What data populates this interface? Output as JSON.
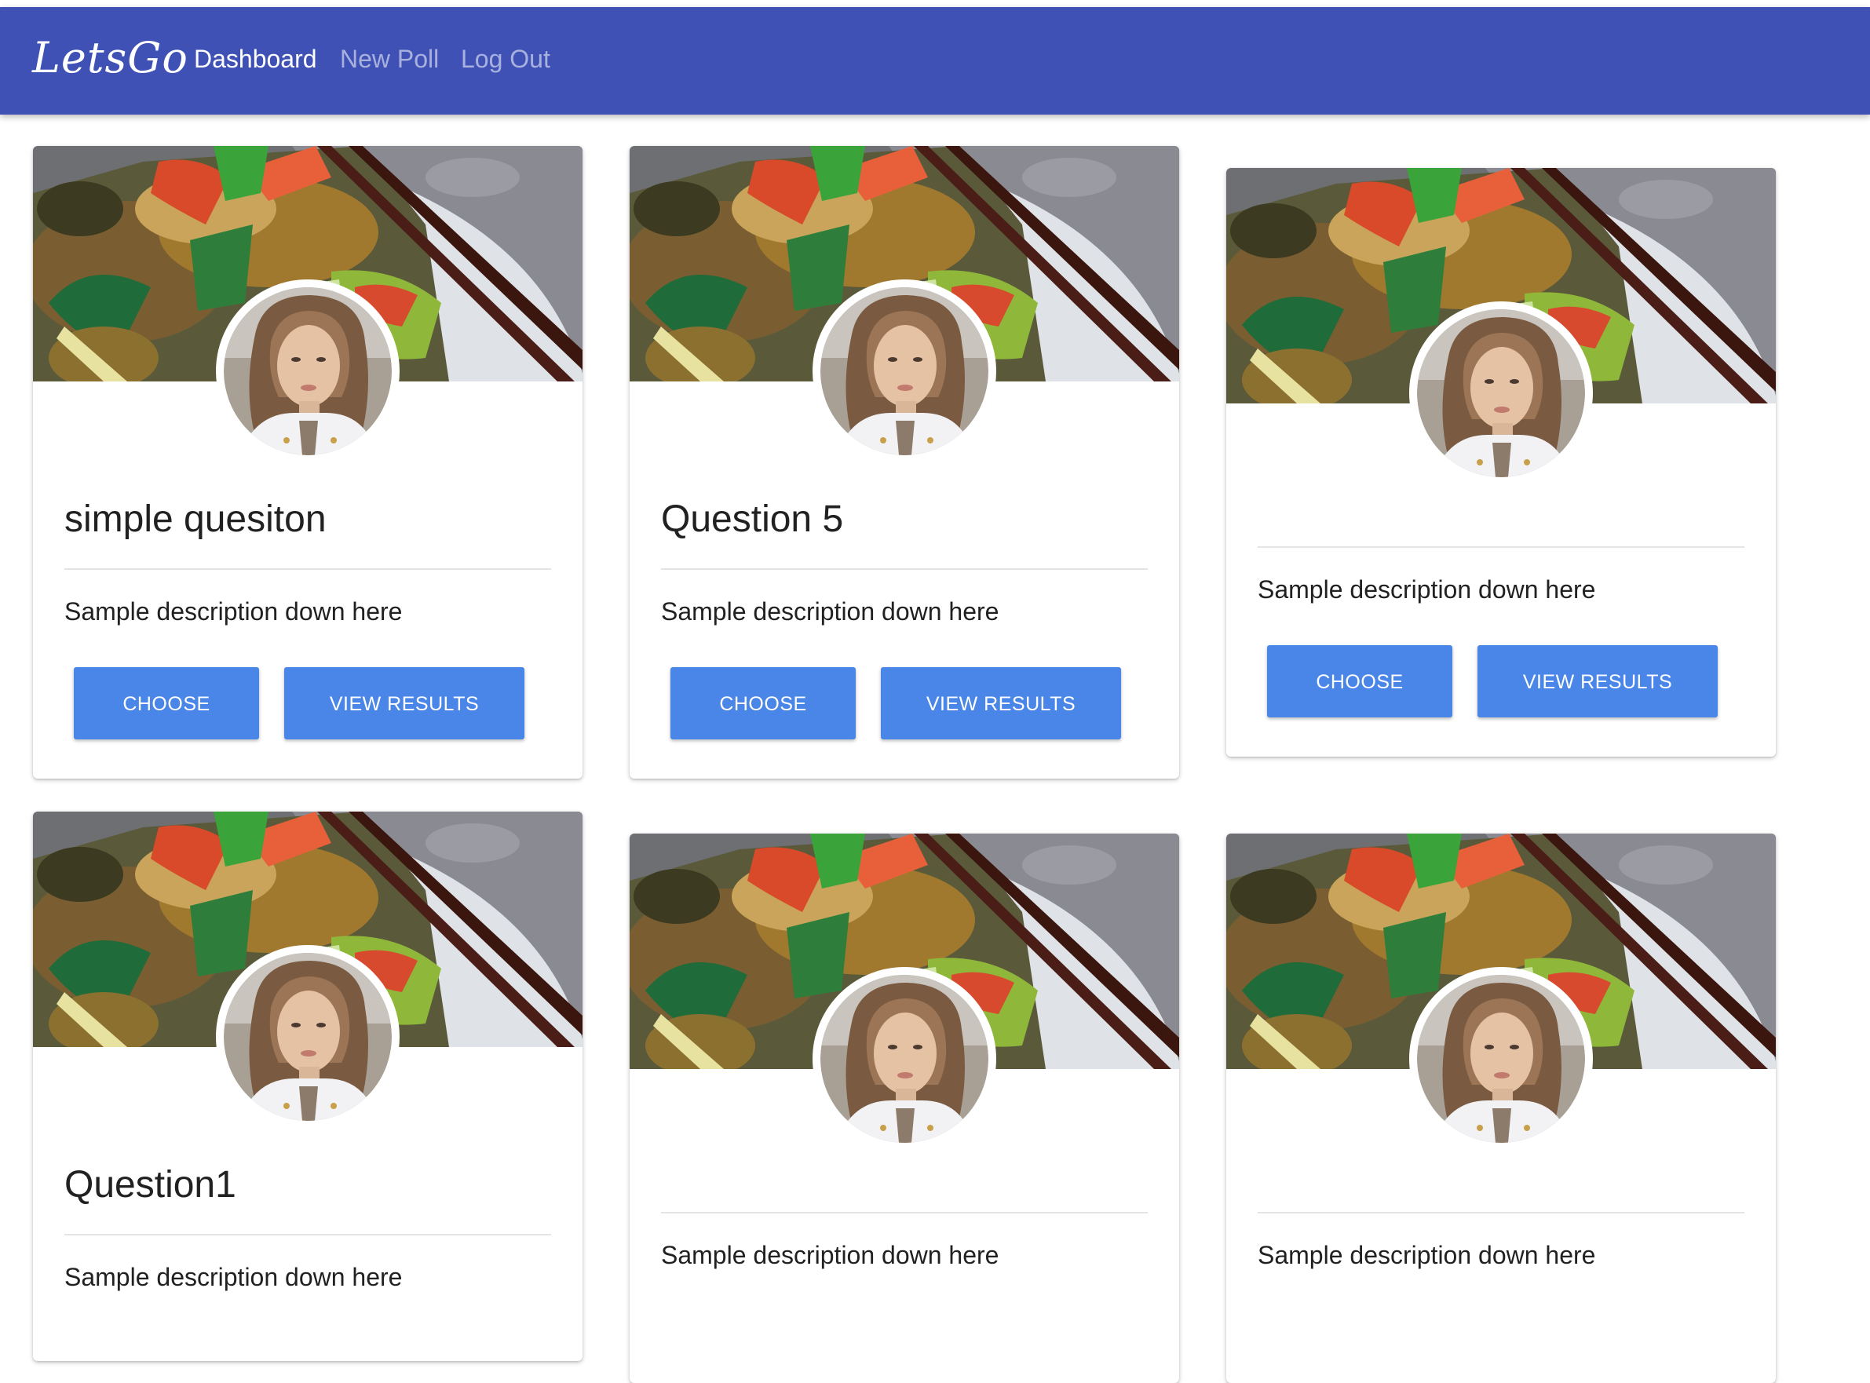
{
  "navbar": {
    "brand": "LetsGo",
    "links": [
      "Dashboard",
      "New Poll",
      "Log Out"
    ]
  },
  "cards": [
    {
      "title": "simple quesiton",
      "description": "Sample description down here",
      "choose_label": "CHOOSE",
      "results_label": "VIEW RESULTS"
    },
    {
      "title": "Question 5",
      "description": "Sample description down here",
      "choose_label": "CHOOSE",
      "results_label": "VIEW RESULTS"
    },
    {
      "title": "",
      "description": "Sample description down here",
      "choose_label": "CHOOSE",
      "results_label": "VIEW RESULTS"
    },
    {
      "title": "Question1",
      "description": "Sample description down here"
    },
    {
      "title": "",
      "description": "Sample description down here"
    },
    {
      "title": "",
      "description": "Sample description down here"
    }
  ],
  "colors": {
    "navbar": "#3f51b5",
    "button": "#4a86e8",
    "button_text": "#ffffff"
  },
  "icons": {
    "cover_image": "food-stir-fry-photo",
    "avatar_image": "user-avatar-photo"
  }
}
